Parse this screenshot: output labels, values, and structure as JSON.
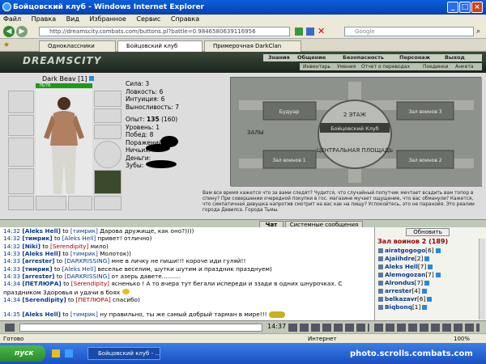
{
  "window": {
    "title": "Бойцовский клуб - Windows Internet Explorer"
  },
  "menu": [
    "Файл",
    "Правка",
    "Вид",
    "Избранное",
    "Сервис",
    "Справка"
  ],
  "address": {
    "url": "http://dreamscity.combats.com/buttons.pl?battle=0.9846580639116956"
  },
  "search": {
    "placeholder": "Google"
  },
  "tabs": [
    {
      "label": "Одноклассники"
    },
    {
      "label": "Бойцовский клуб"
    },
    {
      "label": "Примерочная DarkClan"
    }
  ],
  "game": {
    "logo": "DREAMSCITY",
    "topnav": [
      "Знания",
      "Общение",
      "Безопасность",
      "Персонаж",
      "Выход"
    ],
    "subnav": [
      "Инвентарь",
      "Умения",
      "Отчет о переводах",
      "Поединки",
      "Анкета"
    ],
    "character": {
      "name": "Dark Beav",
      "level": "[1]",
      "hp": "76/76"
    },
    "stats": [
      {
        "label": "Сила:",
        "value": "3"
      },
      {
        "label": "Ловкость:",
        "value": "6"
      },
      {
        "label": "Интуиция:",
        "value": "6"
      },
      {
        "label": "Выносливость:",
        "value": "7"
      }
    ],
    "progress": [
      {
        "label": "Опыт:",
        "value": "135",
        "extra": "(160)"
      },
      {
        "label": "Уровень:",
        "value": "1"
      },
      {
        "label": "Побед:",
        "value": "8"
      },
      {
        "label": "Поражений:",
        "value": "0"
      },
      {
        "label": "Ничьих:",
        "value": ""
      },
      {
        "label": "Деньги:",
        "value": ""
      },
      {
        "label": "Зубы:",
        "value": ""
      }
    ],
    "map": {
      "center_floor": "2 ЭТАЖ",
      "center_label": "Бойцовский Клуб",
      "center_sub": "ЦЕНТРАЛЬНАЯ ПЛОЩАДЬ",
      "left_top": "Будуар",
      "left_mid": "ЗАЛЫ",
      "left_bottom": "Зал воинов 1",
      "right_top": "Зал воинов 3",
      "right_bottom": "Зал воинов 2"
    },
    "notice": "Вам все время кажется что за вами следят? Чудится, что случайный попутчик мечтает всадить вам топор в спину? При совершении очередной покупки в гос. магазине мучает ощущение, что вас обманули? Кажется, что симпатичная девушка напротив смотрит на вас как на пищу? Успокойтесь, это не паранойя. Это реалии города Девилса. Города Тьмы."
  },
  "chat_tabs": {
    "chat": "Чат",
    "system": "Системные сообщения"
  },
  "chat": [
    {
      "time": "14:32",
      "nick": "[Aleks Hell]",
      "to": "to",
      "target": "[тимрик]",
      "text": "Дарова дружище, как оно?))))"
    },
    {
      "time": "14:32",
      "nick": "[тимрик]",
      "to": "to",
      "target": "[Aleks Hell]",
      "text": "привет! отлично)"
    },
    {
      "time": "14:32",
      "nick": "[Niki]",
      "to": "to",
      "target": "[Serendipity]",
      "text": "мило)"
    },
    {
      "time": "14:33",
      "nick": "[Aleks Hell]",
      "to": "to",
      "target": "[тимрик]",
      "text": "Молоток))"
    },
    {
      "time": "14:33",
      "nick": "[arrester]",
      "to": "to",
      "target": "[DARKRISSING]",
      "text": "мне в личку не пиши!!! короче иди гуляй!!"
    },
    {
      "time": "14:33",
      "nick": "[тимрик]",
      "to": "to",
      "target": "[Aleks Hell]",
      "text": "веселье веселим, шутки шутим и праздник празднуем)"
    },
    {
      "time": "14:33",
      "nick": "[arrester]",
      "to": "to",
      "target": "[DARKRISSING]",
      "text": "от азерь давете.........."
    },
    {
      "time": "14:34",
      "nick": "[ПЕТЛЮРА]",
      "to": "to",
      "target": "[Serendipity]",
      "text": "ясненько ! А то вчера тут бегали испереди и ззади в одних шнурочках. С"
    },
    {
      "time": "",
      "nick": "",
      "to": "",
      "target": "",
      "text": "праздником Здоровья и удачи в боях"
    },
    {
      "time": "14:34",
      "nick": "[Serendipity]",
      "to": "to",
      "target": "[ПЕТЛЮРА]",
      "text": "спасибо)"
    },
    {
      "time": "14:35",
      "nick": "[Aleks Hell]",
      "to": "to",
      "target": "[тимрик]",
      "text": "ну правильно, ты же самый добрый тарман в мире!!!"
    }
  ],
  "room": {
    "refresh": "Обновить",
    "title": "Зал воинов 2 (189)",
    "users": [
      {
        "name": "airatgogogo",
        "level": "[6]"
      },
      {
        "name": "Ajaiihdre",
        "level": "[2]"
      },
      {
        "name": "Aleks Hell",
        "level": "[7]"
      },
      {
        "name": "Alemogozan",
        "level": "[7]"
      },
      {
        "name": "Alrondus",
        "level": "[7]"
      },
      {
        "name": "arrester",
        "level": "[4]"
      },
      {
        "name": "belkazavr",
        "level": "[6]"
      },
      {
        "name": "Biqbonq",
        "level": "[1]"
      }
    ]
  },
  "clock": "14:37",
  "status": {
    "left": "Готово",
    "zone": "Интернет",
    "zoom": "100%"
  },
  "taskbar": {
    "start": "пуск",
    "item": "Бойцовский клуб - ...",
    "watermark": "photo.scrolls.combats.com"
  }
}
